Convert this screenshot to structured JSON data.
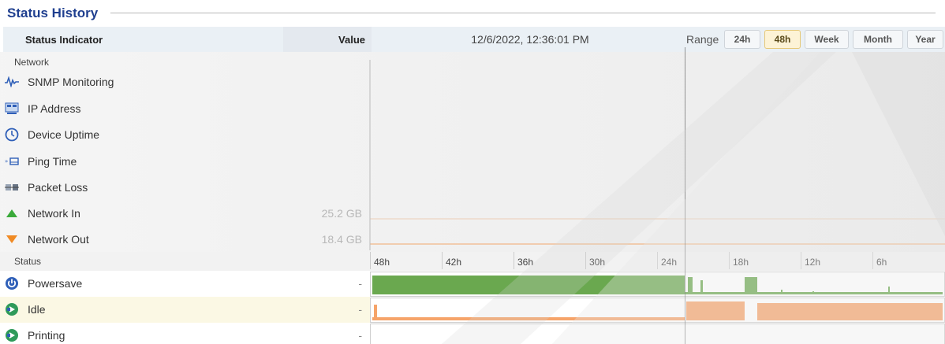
{
  "page": {
    "title": "Status History"
  },
  "header": {
    "indicator_label": "Status Indicator",
    "value_label": "Value",
    "timestamp": "12/6/2022, 12:36:01 PM",
    "range_label": "Range",
    "range_buttons": [
      "24h",
      "48h",
      "Week",
      "Month",
      "Year"
    ],
    "range_active": "48h"
  },
  "network": {
    "section_label": "Network",
    "rows": [
      {
        "label": "SNMP Monitoring",
        "value": "",
        "icon": "snmp-pulse-icon"
      },
      {
        "label": "IP Address",
        "value": "",
        "icon": "network-card-icon"
      },
      {
        "label": "Device Uptime",
        "value": "",
        "icon": "clock-icon"
      },
      {
        "label": "Ping Time",
        "value": "",
        "icon": "ping-icon"
      },
      {
        "label": "Packet Loss",
        "value": "",
        "icon": "packet-loss-icon"
      },
      {
        "label": "Network In",
        "value": "25.2 GB",
        "icon": "arrow-up-icon"
      },
      {
        "label": "Network Out",
        "value": "18.4 GB",
        "icon": "arrow-down-icon"
      }
    ]
  },
  "status": {
    "section_label": "Status",
    "axis_ticks": [
      "48h",
      "42h",
      "36h",
      "30h",
      "24h",
      "18h",
      "12h",
      "6h"
    ],
    "rows": [
      {
        "label": "Powersave",
        "value": "-",
        "icon": "power-icon",
        "color": "#6aa84f"
      },
      {
        "label": "Idle",
        "value": "-",
        "icon": "idle-arrow-icon",
        "color": "#f6a46a"
      },
      {
        "label": "Printing",
        "value": "-",
        "icon": "printing-arrow-icon",
        "color": "#f6a46a"
      }
    ]
  },
  "colors": {
    "accent": "#1f3f8f",
    "powersave": "#6aa84f",
    "idle": "#f6a46a",
    "network_in": "#3aaa3a",
    "network_out": "#f08a24"
  }
}
